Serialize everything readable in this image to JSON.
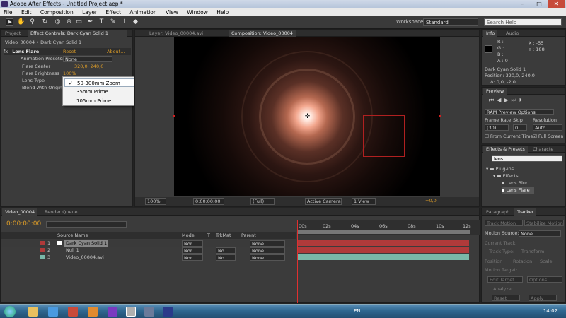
{
  "window": {
    "title": "Adobe After Effects - Untitled Project.aep *",
    "minimize": "–",
    "maximize": "□",
    "close": "✕"
  },
  "menu": [
    "File",
    "Edit",
    "Composition",
    "Layer",
    "Effect",
    "Animation",
    "View",
    "Window",
    "Help"
  ],
  "toolbar": {
    "workspace_label": "Workspace:",
    "workspace_value": "Standard",
    "search_placeholder": "Search Help"
  },
  "left_panel": {
    "tab_project": "Project",
    "tab_effect_controls": "Effect Controls: Dark Cyan Solid 1",
    "subtitle": "Video_00004 • Dark Cyan Solid 1",
    "effect_name": "Lens Flare",
    "reset": "Reset",
    "about": "About...",
    "animation_presets_label": "Animation Presets:",
    "animation_presets_value": "None",
    "flare_center_label": "Flare Center",
    "flare_center_value": "320,0, 240,0",
    "flare_brightness_label": "Flare Brightness",
    "flare_brightness_value": "100%",
    "lens_type_label": "Lens Type",
    "blend_label": "Blend With Original",
    "lens_options": [
      {
        "label": "50-300mm Zoom",
        "checked": true
      },
      {
        "label": "35mm Prime",
        "checked": false
      },
      {
        "label": "105mm Prime",
        "checked": false
      }
    ]
  },
  "comp_panel": {
    "tab_layer": "Layer: Video_00004.avi",
    "tab_comp": "Composition: Video_00004",
    "zoom": "100%",
    "timecode": "0:00:00:00",
    "resolution": "(Full)",
    "camera": "Active Camera",
    "view": "1 View",
    "exposure": "+0,0"
  },
  "info_panel": {
    "tab_info": "Info",
    "tab_audio": "Audio",
    "r": "R :",
    "g": "G :",
    "b": "B :",
    "a": "A : 0",
    "x": "X : -55",
    "y": "Y : 188",
    "layer_name": "Dark Cyan Solid 1",
    "position": "Position: 320,0, 240,0",
    "delta": "Δ: 0,0, -2,0"
  },
  "preview_panel": {
    "title": "Preview",
    "ram_options": "RAM Preview Options",
    "frame_rate_label": "Frame Rate",
    "skip_label": "Skip",
    "resolution_label": "Resolution",
    "frame_rate_value": "(30)",
    "skip_value": "0",
    "resolution_value": "Auto",
    "from_current": "From Current Time",
    "full_screen": "Full Screen"
  },
  "effects_panel": {
    "tab_effects": "Effects & Presets",
    "tab_character": "Characte",
    "search_value": "lens",
    "tree": [
      "Plug-ins",
      "Effects",
      "Lens Blur",
      "Lens Flare"
    ]
  },
  "timeline": {
    "tab_comp": "Video_00004",
    "tab_render": "Render Queue",
    "timecode": "0:00:00:00",
    "col_source": "Source Name",
    "col_mode": "Mode",
    "col_t": "T",
    "col_trkmat": "TrkMat",
    "col_parent": "Parent",
    "ruler": [
      "00s",
      "02s",
      "04s",
      "06s",
      "08s",
      "10s",
      "12s"
    ],
    "layers": [
      {
        "num": "1",
        "name": "Dark Cyan Solid 1",
        "mode": "Nor",
        "trkmat": "",
        "parent": "None",
        "color": "#b03a3a"
      },
      {
        "num": "2",
        "name": "Null 1",
        "mode": "Nor",
        "trkmat": "No",
        "parent": "None",
        "color": "#b03a3a"
      },
      {
        "num": "3",
        "name": "Video_00004.avi",
        "mode": "Nor",
        "trkmat": "No",
        "parent": "None",
        "color": "#7ab7a8"
      }
    ]
  },
  "tracker_panel": {
    "tab_paragraph": "Paragraph",
    "tab_tracker": "Tracker",
    "track_motion": "Track Motion",
    "stabilize": "Stabilize Motion",
    "motion_source_label": "Motion Source:",
    "motion_source_value": "None",
    "current_track": "Current Track:",
    "track_type": "Track Type:",
    "track_type_value": "Transform",
    "position": "Position",
    "rotation": "Rotation",
    "scale": "Scale",
    "motion_target": "Motion Target:",
    "edit_target": "Edit Target...",
    "options": "Options...",
    "analyze": "Analyze:",
    "reset": "Reset",
    "apply": "Apply"
  },
  "taskbar": {
    "lang": "EN",
    "time": "14:02"
  },
  "colors": {
    "accent_orange": "#d99a28",
    "layer_red": "#b03a3a",
    "layer_teal": "#7ab7a8"
  }
}
